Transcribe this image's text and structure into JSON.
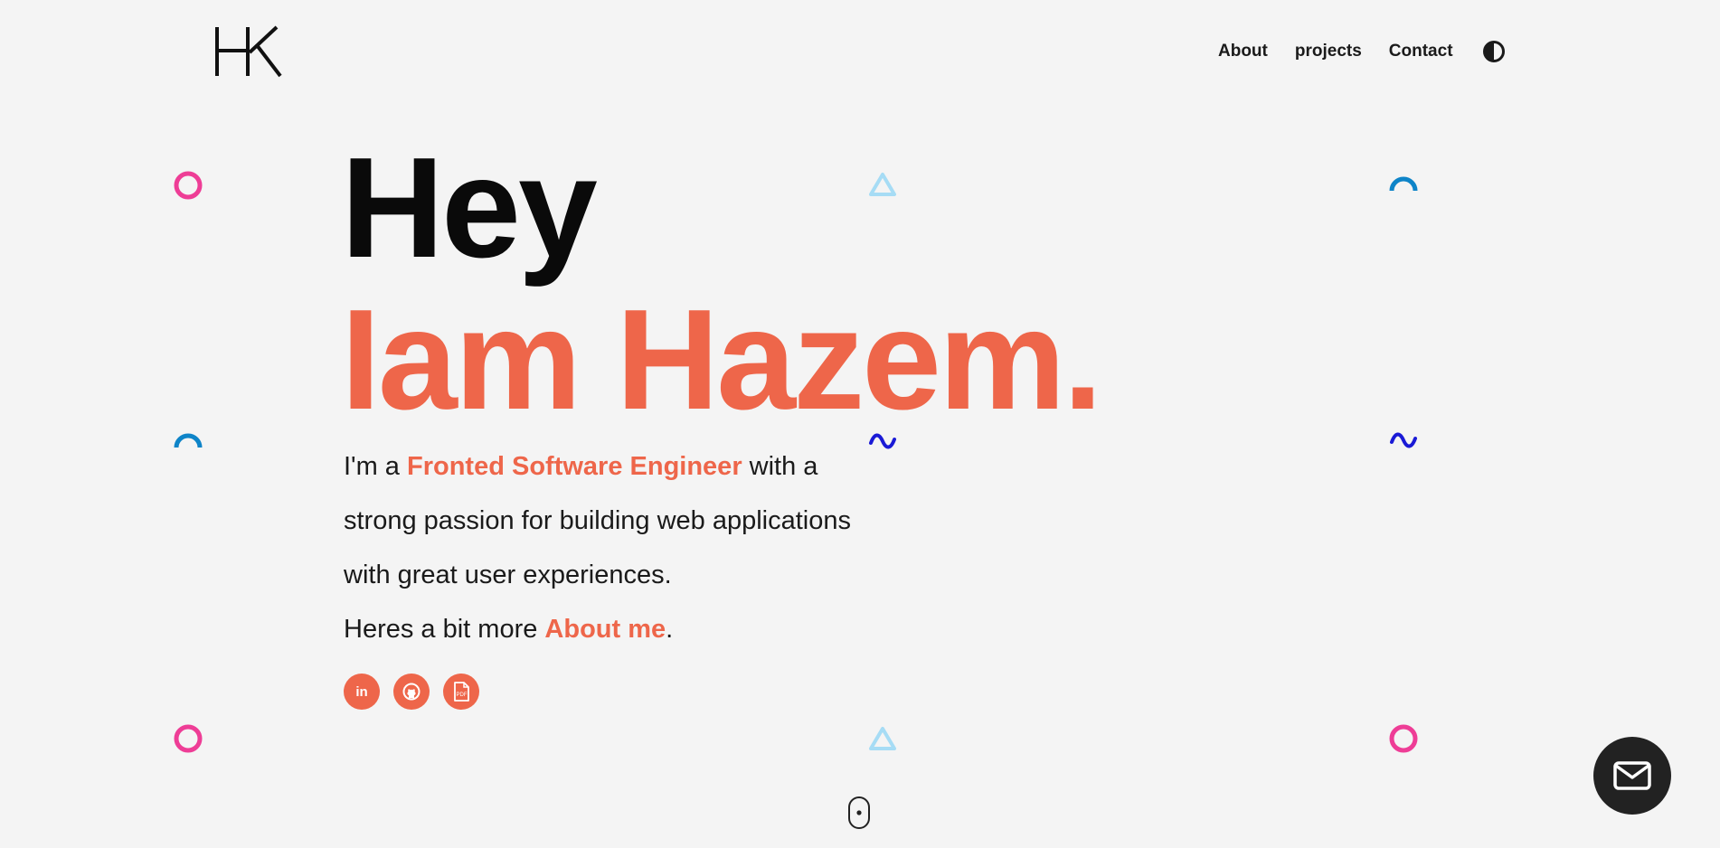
{
  "header": {
    "logo_text": "HK",
    "nav": [
      {
        "label": "About"
      },
      {
        "label": "projects"
      },
      {
        "label": "Contact"
      }
    ]
  },
  "hero": {
    "greeting": "Hey",
    "name": "Iam Hazem.",
    "intro_prefix": "I'm a ",
    "intro_role": "Fronted Software Engineer",
    "intro_rest": " with a strong passion for building web applications with great user experiences.",
    "more_prefix": "Heres a bit more ",
    "more_link": "About me",
    "more_suffix": "."
  },
  "socials": [
    {
      "name": "linkedin",
      "glyph": "in"
    },
    {
      "name": "github",
      "glyph": ""
    },
    {
      "name": "resume-pdf",
      "glyph": "PDF"
    }
  ],
  "colors": {
    "accent": "#ee664a",
    "background": "#f4f4f4",
    "pink": "#ee3d96",
    "blue": "#0e84c8",
    "light_blue": "#a6dcf5",
    "navy": "#1a1ad6"
  }
}
